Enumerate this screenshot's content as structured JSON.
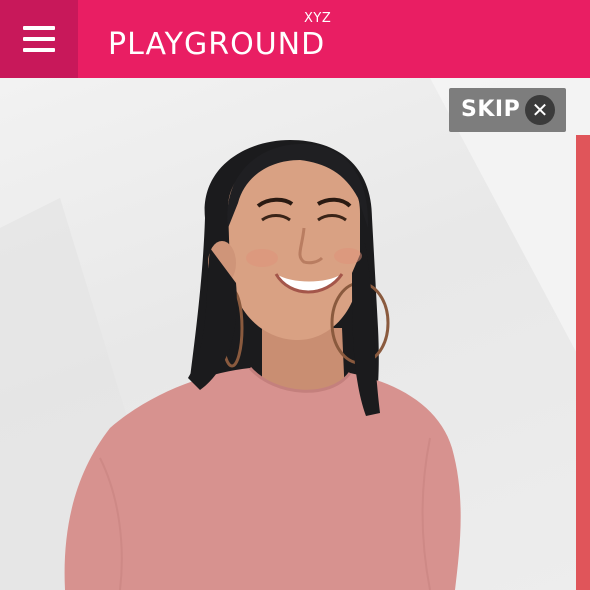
{
  "header": {
    "logo_text": "PLAYGROUND",
    "logo_sup": "XYZ",
    "background_color": "#e91e63",
    "menu_icon": "hamburger-menu-icon"
  },
  "overlay": {
    "skip_label": "SKIP",
    "close_icon": "close-icon",
    "close_glyph": "✕"
  },
  "hero": {
    "subject": "smiling person with black shoulder-length hair, hoop earrings and a pink t-shirt"
  }
}
